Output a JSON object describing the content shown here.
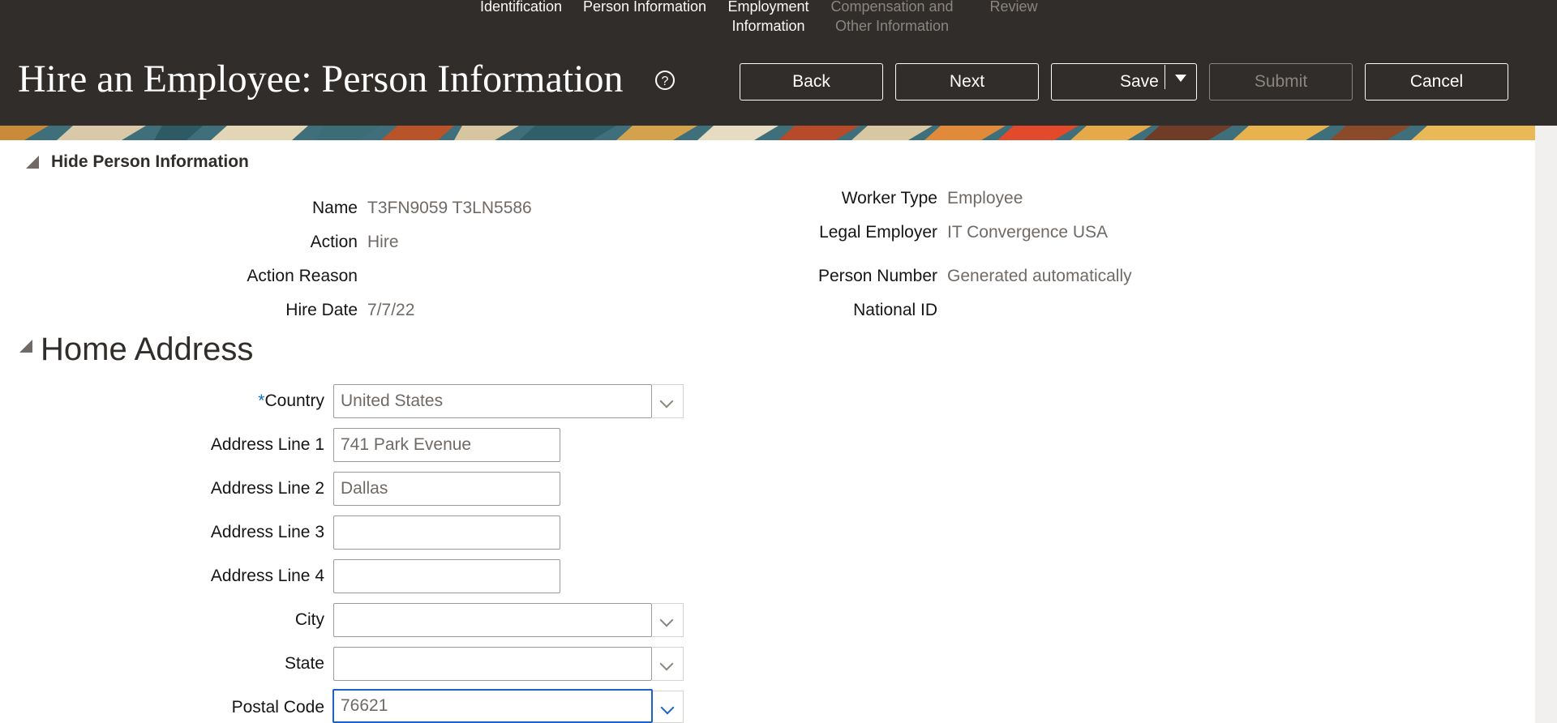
{
  "train": {
    "steps": [
      {
        "line1": "Identification",
        "line2": ""
      },
      {
        "line1": "Person Information",
        "line2": ""
      },
      {
        "line1": "Employment",
        "line2": "Information"
      },
      {
        "line1": "Compensation and",
        "line2": "Other Information"
      },
      {
        "line1": "Review",
        "line2": ""
      }
    ]
  },
  "header": {
    "title": "Hire an Employee: Person Information",
    "buttons": {
      "back": "Back",
      "next": "Next",
      "save": "Save",
      "submit": "Submit",
      "cancel": "Cancel"
    }
  },
  "person_info": {
    "section_title": "Hide Person Information",
    "left": [
      {
        "label": "Name",
        "value": "T3FN9059 T3LN5586"
      },
      {
        "label": "Action",
        "value": "Hire"
      },
      {
        "label": "Action Reason",
        "value": ""
      },
      {
        "label": "Hire Date",
        "value": "7/7/22"
      }
    ],
    "right": [
      {
        "label": "Worker Type",
        "value": "Employee"
      },
      {
        "label": "Legal Employer",
        "value": "IT Convergence USA"
      },
      {
        "label": "Person Number",
        "value": "Generated automatically"
      },
      {
        "label": "National ID",
        "value": ""
      }
    ]
  },
  "home_address": {
    "title": "Home Address",
    "required_mark": "*",
    "fields": {
      "country": {
        "label": "Country",
        "value": "United States"
      },
      "address1": {
        "label": "Address Line 1",
        "value": "741 Park Evenue"
      },
      "address2": {
        "label": "Address Line 2",
        "value": "Dallas"
      },
      "address3": {
        "label": "Address Line 3",
        "value": ""
      },
      "address4": {
        "label": "Address Line 4",
        "value": ""
      },
      "city": {
        "label": "City",
        "value": ""
      },
      "state": {
        "label": "State",
        "value": ""
      },
      "postal": {
        "label": "Postal Code",
        "value": "76621"
      }
    }
  },
  "colors": {
    "header_bg": "#312d2a",
    "focus_border": "#1a62c4",
    "required": "#0572ce"
  }
}
